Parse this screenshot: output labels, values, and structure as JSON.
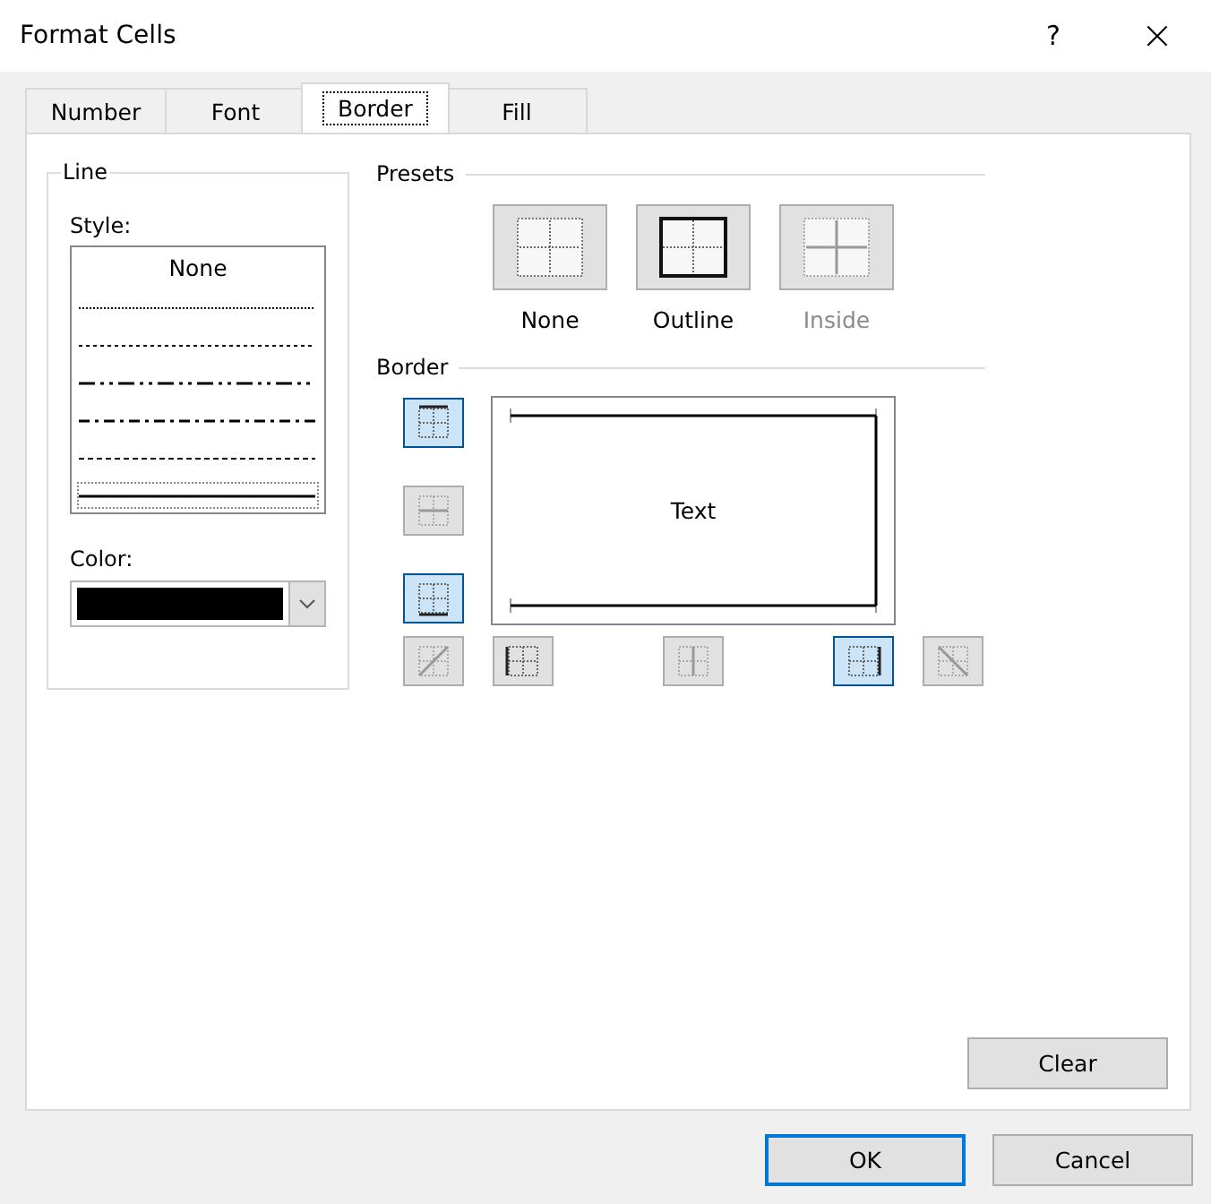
{
  "window": {
    "title": "Format Cells",
    "help_button": "?",
    "close_button": "×"
  },
  "tabs": [
    {
      "label": "Number",
      "selected": false
    },
    {
      "label": "Font",
      "selected": false
    },
    {
      "label": "Border",
      "selected": true
    },
    {
      "label": "Fill",
      "selected": false
    }
  ],
  "line": {
    "title": "Line",
    "style_label": {
      "text": "Style:"
    },
    "styles": [
      {
        "kind": "none",
        "label": "None",
        "selected": false
      },
      {
        "kind": "hair",
        "selected": false
      },
      {
        "kind": "dotted",
        "selected": false
      },
      {
        "kind": "dash-dot-dot",
        "selected": false
      },
      {
        "kind": "dash-dot",
        "selected": false
      },
      {
        "kind": "dashed",
        "selected": false
      },
      {
        "kind": "thin",
        "selected": true
      }
    ],
    "color_label": {
      "text": "Color:"
    },
    "color": "#000000"
  },
  "presets": {
    "title": "Presets",
    "items": [
      {
        "kind": "none",
        "label": "None",
        "disabled": false
      },
      {
        "kind": "outline",
        "label": "Outline",
        "disabled": false
      },
      {
        "kind": "inside",
        "label": "Inside",
        "disabled": true
      }
    ]
  },
  "border": {
    "title": "Border",
    "preview_text": "Text",
    "buttons": [
      {
        "kind": "top",
        "selected": true,
        "disabled": false
      },
      {
        "kind": "inside-horizontal",
        "selected": false,
        "disabled": true
      },
      {
        "kind": "bottom",
        "selected": true,
        "disabled": false
      },
      {
        "kind": "diagonal-up",
        "selected": false,
        "disabled": true
      },
      {
        "kind": "left",
        "selected": false,
        "disabled": false
      },
      {
        "kind": "inside-vertical",
        "selected": false,
        "disabled": true
      },
      {
        "kind": "right",
        "selected": true,
        "disabled": false
      },
      {
        "kind": "diagonal-down",
        "selected": false,
        "disabled": true
      }
    ]
  },
  "clear_button": {
    "label": "Clear"
  },
  "buttons": [
    {
      "label": "OK",
      "default": true
    },
    {
      "label": "Cancel",
      "default": false
    }
  ]
}
